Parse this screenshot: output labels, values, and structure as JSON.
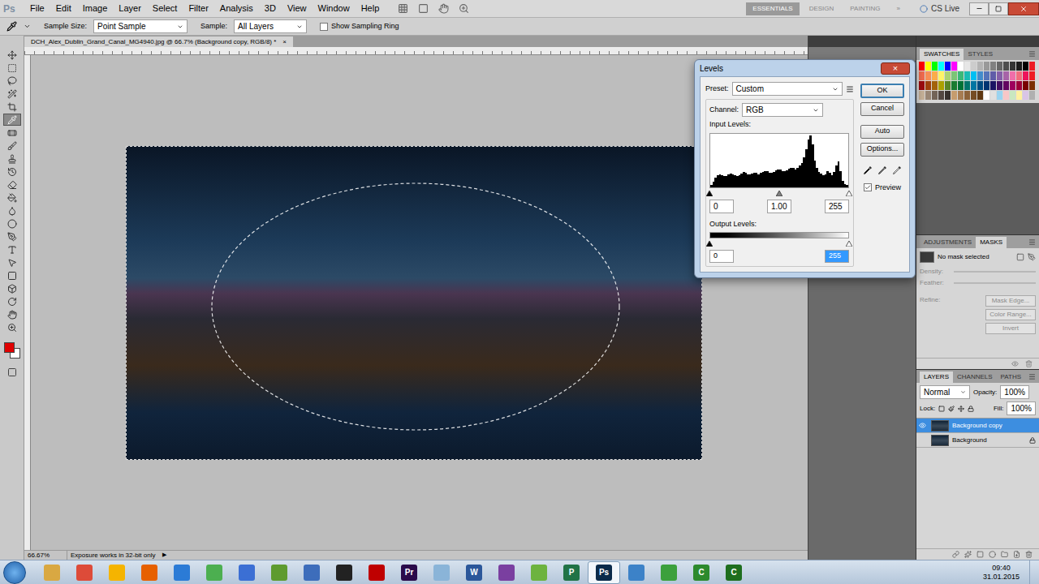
{
  "app": {
    "logo": "Ps"
  },
  "menu": [
    "File",
    "Edit",
    "Image",
    "Layer",
    "Select",
    "Filter",
    "Analysis",
    "3D",
    "View",
    "Window",
    "Help"
  ],
  "workspaces": [
    {
      "label": "ESSENTIALS",
      "selected": true
    },
    {
      "label": "DESIGN",
      "selected": false
    },
    {
      "label": "PAINTING",
      "selected": false
    },
    {
      "label": "»",
      "selected": false
    }
  ],
  "cs_live": "CS Live",
  "options_bar": {
    "sample_size_label": "Sample Size:",
    "sample_size": "Point Sample",
    "sample_label": "Sample:",
    "sample": "All Layers",
    "show_ring": {
      "label": "Show Sampling Ring",
      "checked": false
    }
  },
  "document": {
    "tab": "DCH_Alex_Dublin_Grand_Canal_MG4940.jpg @ 66.7% (Background copy, RGB/8) *",
    "close": "×"
  },
  "tools": [
    {
      "selected": false
    },
    {
      "selected": false
    },
    {
      "selected": false
    },
    {
      "selected": false
    },
    {
      "selected": false
    },
    {
      "selected": true
    },
    {
      "selected": false
    },
    {
      "selected": false
    },
    {
      "selected": false
    },
    {
      "selected": false
    },
    {
      "selected": false
    },
    {
      "selected": false
    },
    {
      "selected": false
    },
    {
      "selected": false
    },
    {
      "selected": false
    },
    {
      "selected": false
    },
    {
      "selected": false
    },
    {
      "selected": false
    },
    {
      "selected": false
    },
    {
      "selected": false
    },
    {
      "selected": false
    },
    {
      "selected": false
    }
  ],
  "colors": {
    "foreground": "#e00000",
    "background": "#ffffff"
  },
  "status_bar": {
    "zoom": "66.67%",
    "info": "Exposure works in 32-bit only",
    "arrow": "▶"
  },
  "levels": {
    "title": "Levels",
    "close": "×",
    "preset_label": "Preset:",
    "preset": "Custom",
    "channel_label": "Channel:",
    "channel": "RGB",
    "input_label": "Input Levels:",
    "histogram": [
      4,
      10,
      18,
      22,
      24,
      22,
      20,
      21,
      23,
      25,
      24,
      22,
      20,
      22,
      25,
      28,
      26,
      24,
      23,
      25,
      27,
      26,
      24,
      26,
      28,
      30,
      29,
      27,
      26,
      28,
      31,
      33,
      32,
      30,
      29,
      31,
      34,
      36,
      35,
      33,
      36,
      40,
      45,
      55,
      70,
      88,
      96,
      80,
      50,
      35,
      28,
      25,
      22,
      24,
      30,
      26,
      22,
      28,
      40,
      48,
      30,
      12,
      6,
      4
    ],
    "input_sliders": [
      {
        "level": 0,
        "color": "#000000"
      },
      {
        "level": 0.5,
        "color": "#808080"
      },
      {
        "level": 1,
        "color": "#ffffff"
      }
    ],
    "input_values": [
      "0",
      "1.00",
      "255"
    ],
    "output_label": "Output Levels:",
    "output_sliders": [
      {
        "level": 0,
        "color": "#000000"
      },
      {
        "level": 1,
        "color": "#ffffff"
      }
    ],
    "output_values": [
      {
        "value": "0",
        "selected": false
      },
      {
        "value": "255",
        "selected": true
      }
    ],
    "buttons": [
      {
        "label": "OK",
        "default": true
      },
      {
        "label": "Cancel",
        "default": false
      },
      {
        "label": "Auto",
        "default": false
      },
      {
        "label": "Options...",
        "default": false
      }
    ],
    "eyedroppers": [
      {
        "color": "#000000"
      },
      {
        "color": "#808080"
      },
      {
        "color": "#ffffff"
      }
    ],
    "preview": {
      "label": "Preview",
      "checked": true
    }
  },
  "swatches": {
    "tabs": [
      {
        "label": "SWATCHES",
        "selected": true
      },
      {
        "label": "STYLES",
        "selected": false
      }
    ],
    "colors": [
      "#ff0000",
      "#ffff00",
      "#00ff00",
      "#00ffff",
      "#0000ff",
      "#ff00ff",
      "#ffffff",
      "#e6e6e6",
      "#cccccc",
      "#b3b3b3",
      "#999999",
      "#808080",
      "#666666",
      "#4d4d4d",
      "#333333",
      "#1a1a1a",
      "#000000",
      "#ed1c24",
      "#f26c4f",
      "#f68e55",
      "#fbad4a",
      "#fff467",
      "#acd372",
      "#7cc576",
      "#3bb878",
      "#1abbb4",
      "#00bff3",
      "#438ccb",
      "#5574b9",
      "#605ca8",
      "#855fa8",
      "#a763a8",
      "#f06ea9",
      "#f26d7d",
      "#ed145b",
      "#ee1d24",
      "#9e0b0f",
      "#a0410d",
      "#a3620a",
      "#aba000",
      "#598527",
      "#1a7b30",
      "#007236",
      "#00746b",
      "#0076a3",
      "#004b80",
      "#003471",
      "#1b1464",
      "#440e62",
      "#630460",
      "#9e005d",
      "#9e0039",
      "#790000",
      "#7b2e00",
      "#c7b299",
      "#998675",
      "#736357",
      "#534741",
      "#37302d",
      "#c69c6e",
      "#a67c52",
      "#8c6239",
      "#754c24",
      "#603913",
      "#ffffff",
      "#e0e0e0",
      "#9ad3f0",
      "#f7c6c7",
      "#c9e7c0",
      "#fff0a0",
      "#d9c4e6",
      "#b0b0b0"
    ]
  },
  "masks": {
    "tabs": [
      {
        "label": "ADJUSTMENTS",
        "selected": false
      },
      {
        "label": "MASKS",
        "selected": true
      }
    ],
    "status": "No mask selected",
    "fields": [
      {
        "label": "Density:",
        "disabled": true
      },
      {
        "label": "Feather:",
        "disabled": true
      }
    ],
    "refine_label": "Refine:",
    "buttons": [
      {
        "label": "Mask Edge...",
        "disabled": true
      },
      {
        "label": "Color Range...",
        "disabled": true
      },
      {
        "label": "Invert",
        "disabled": true
      }
    ]
  },
  "layers": {
    "tabs": [
      {
        "label": "LAYERS",
        "selected": true
      },
      {
        "label": "CHANNELS",
        "selected": false
      },
      {
        "label": "PATHS",
        "selected": false
      }
    ],
    "blend_mode": "Normal",
    "opacity_label": "Opacity:",
    "opacity": "100%",
    "lock_label": "Lock:",
    "fill_label": "Fill:",
    "fill": "100%",
    "items": [
      {
        "name": "Background copy",
        "selected": true,
        "visible": true,
        "locked": false
      },
      {
        "name": "Background",
        "selected": false,
        "visible": false,
        "locked": true
      }
    ]
  },
  "taskbar": {
    "apps": [
      {
        "color": "#d9a842",
        "active": false
      },
      {
        "color": "#dd4b39",
        "active": false
      },
      {
        "color": "#f5b400",
        "active": false
      },
      {
        "color": "#e66000",
        "active": false
      },
      {
        "color": "#2b7bd6",
        "active": false
      },
      {
        "color": "#4caf50",
        "active": false
      },
      {
        "color": "#3b6fd4",
        "active": false
      },
      {
        "color": "#5e9b2f",
        "active": false
      },
      {
        "color": "#3d6dbb",
        "active": false
      },
      {
        "color": "#222222",
        "active": false
      },
      {
        "color": "#bf0000",
        "active": false
      },
      {
        "color": "#2a0a4a",
        "active": false,
        "label": "Pr"
      },
      {
        "color": "#8ab4d8",
        "active": false
      },
      {
        "color": "#2b579a",
        "active": false,
        "label": "W"
      },
      {
        "color": "#7a3fa0",
        "active": false
      },
      {
        "color": "#6db33f",
        "active": false
      },
      {
        "color": "#217346",
        "active": false,
        "label": "P"
      },
      {
        "color": "#0a2a4a",
        "active": true,
        "label": "Ps"
      },
      {
        "color": "#3c82c8",
        "active": false
      },
      {
        "color": "#3ca03c",
        "active": false
      },
      {
        "color": "#2d8a2d",
        "active": false,
        "label": "C"
      },
      {
        "color": "#1e6e1e",
        "active": false,
        "label": "C"
      }
    ],
    "time": "09:40",
    "date": "31.01.2015"
  }
}
